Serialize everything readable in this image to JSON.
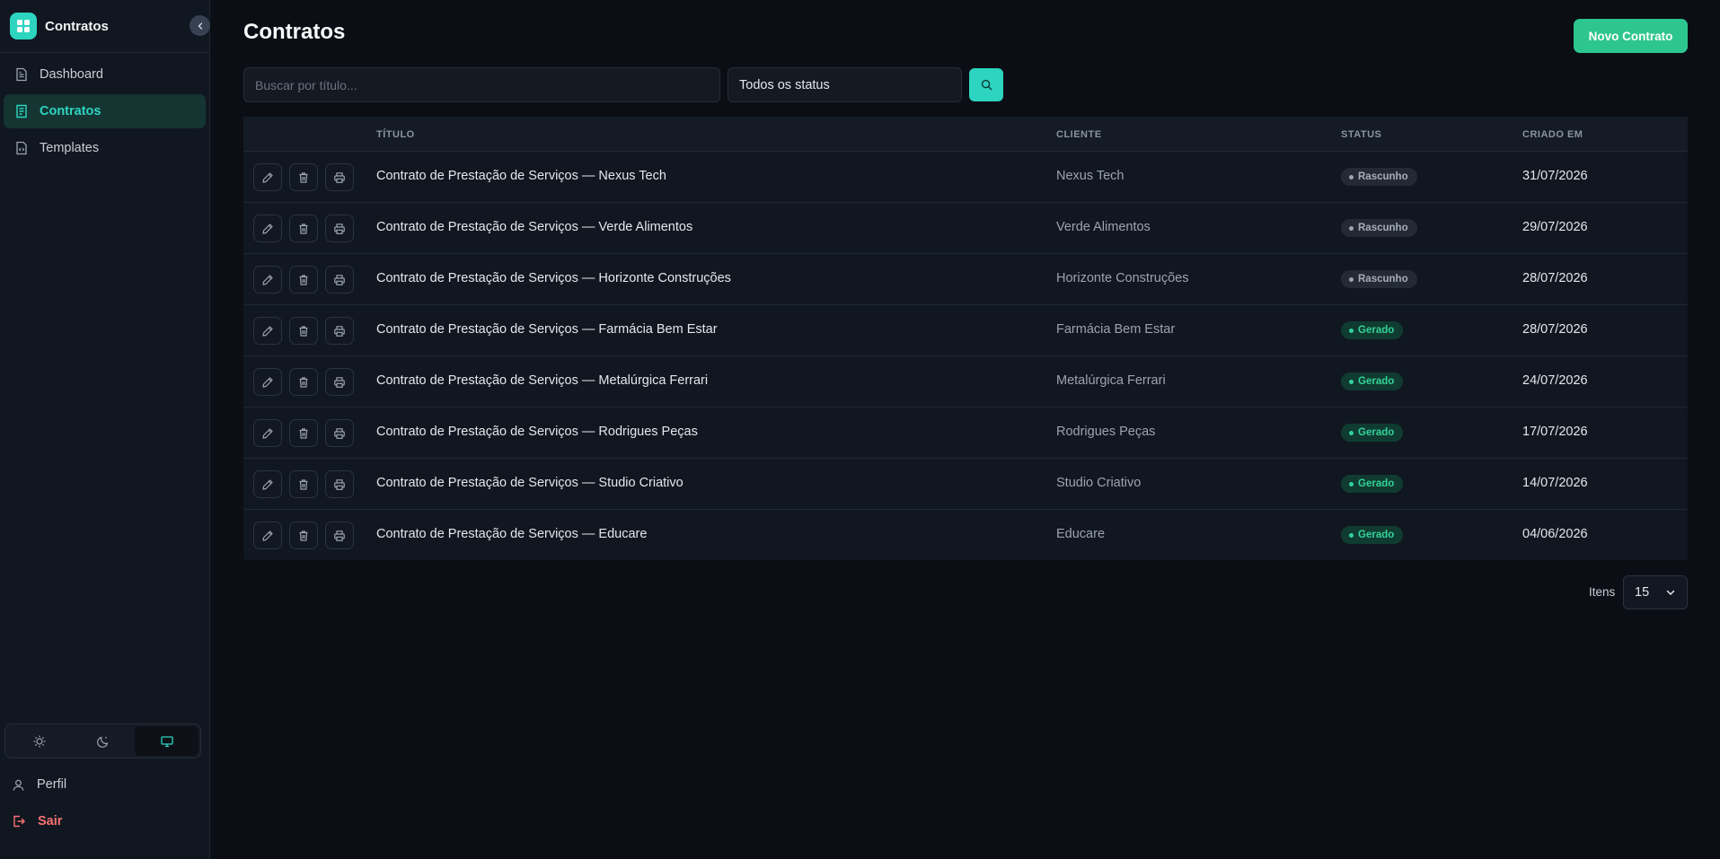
{
  "app": {
    "title": "Contratos"
  },
  "sidebar": {
    "items": [
      {
        "label": "Dashboard",
        "icon": "dashboard-document-icon",
        "active": false
      },
      {
        "label": "Contratos",
        "icon": "contract-document-icon",
        "active": true
      },
      {
        "label": "Templates",
        "icon": "template-code-file-icon",
        "active": false
      }
    ],
    "theme": {
      "options": [
        "light",
        "dark",
        "system"
      ],
      "selected": "system"
    },
    "bottom": [
      {
        "label": "Perfil",
        "icon": "user-icon"
      },
      {
        "label": "Sair",
        "icon": "logout-icon"
      }
    ]
  },
  "header": {
    "title": "Contratos",
    "new_button": "Novo Contrato"
  },
  "filters": {
    "search_placeholder": "Buscar por título...",
    "search_value": "",
    "status_value": "Todos os status"
  },
  "table": {
    "columns": {
      "title": "TÍTULO",
      "client": "CLIENTE",
      "status": "STATUS",
      "created": "CRIADO EM"
    },
    "rows": [
      {
        "title": "Contrato de Prestação de Serviços — Nexus Tech",
        "client": "Nexus Tech",
        "status": "Rascunho",
        "created": "31/07/2026"
      },
      {
        "title": "Contrato de Prestação de Serviços — Verde Alimentos",
        "client": "Verde Alimentos",
        "status": "Rascunho",
        "created": "29/07/2026"
      },
      {
        "title": "Contrato de Prestação de Serviços — Horizonte Construções",
        "client": "Horizonte Construções",
        "status": "Rascunho",
        "created": "28/07/2026"
      },
      {
        "title": "Contrato de Prestação de Serviços — Farmácia Bem Estar",
        "client": "Farmácia Bem Estar",
        "status": "Gerado",
        "created": "28/07/2026"
      },
      {
        "title": "Contrato de Prestação de Serviços — Metalúrgica Ferrari",
        "client": "Metalúrgica Ferrari",
        "status": "Gerado",
        "created": "24/07/2026"
      },
      {
        "title": "Contrato de Prestação de Serviços — Rodrigues Peças",
        "client": "Rodrigues Peças",
        "status": "Gerado",
        "created": "17/07/2026"
      },
      {
        "title": "Contrato de Prestação de Serviços — Studio Criativo",
        "client": "Studio Criativo",
        "status": "Gerado",
        "created": "14/07/2026"
      },
      {
        "title": "Contrato de Prestação de Serviços — Educare",
        "client": "Educare",
        "status": "Gerado",
        "created": "04/06/2026"
      }
    ]
  },
  "pagination": {
    "items_label": "Itens",
    "items_value": "15"
  },
  "colors": {
    "accent": "#2dd4bf",
    "primary_button": "#2ec68f",
    "danger": "#f87171",
    "status_generated": "#34d399",
    "status_draft": "#9ca3af"
  }
}
